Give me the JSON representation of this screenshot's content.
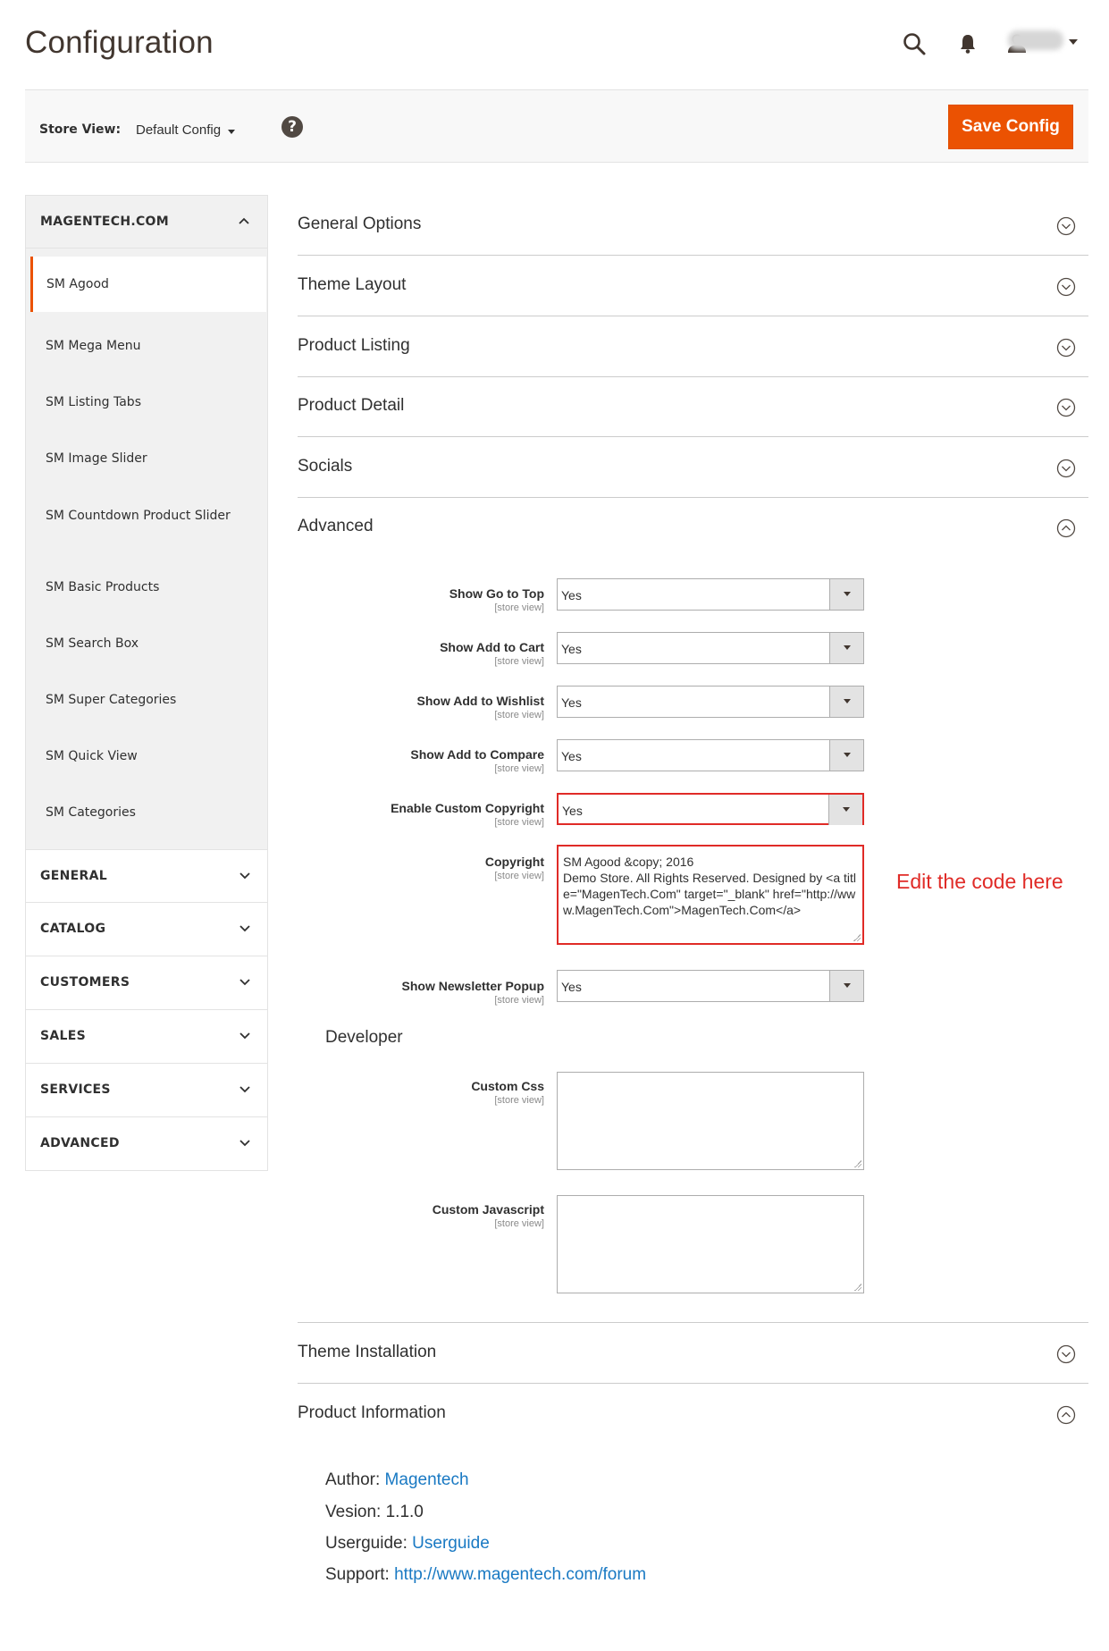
{
  "header": {
    "title": "Configuration",
    "icons": [
      "search-icon",
      "bell-icon",
      "user-icon"
    ]
  },
  "store_view": {
    "label": "Store View:",
    "value": "Default Config",
    "help": "?",
    "save_label": "Save Config"
  },
  "sidebar": {
    "tab_title": "MAGENTECH.COM",
    "items": [
      {
        "label": "SM Agood",
        "active": true
      },
      {
        "label": "SM Mega Menu"
      },
      {
        "label": "SM Listing Tabs"
      },
      {
        "label": "SM Image Slider"
      },
      {
        "label": "SM Countdown Product Slider"
      },
      {
        "label": "SM Basic Products"
      },
      {
        "label": "SM Search Box"
      },
      {
        "label": "SM Super Categories"
      },
      {
        "label": "SM Quick View"
      },
      {
        "label": "SM Categories"
      }
    ],
    "categories": [
      "GENERAL",
      "CATALOG",
      "CUSTOMERS",
      "SALES",
      "SERVICES",
      "ADVANCED"
    ]
  },
  "sections": {
    "general_options": "General Options",
    "theme_layout": "Theme Layout",
    "product_listing": "Product Listing",
    "product_detail": "Product Detail",
    "socials": "Socials",
    "advanced": "Advanced",
    "theme_installation": "Theme Installation",
    "product_information": "Product Information"
  },
  "advanced": {
    "scope": "[store view]",
    "fields": [
      {
        "label": "Show Go to Top",
        "value": "Yes"
      },
      {
        "label": "Show Add to Cart",
        "value": "Yes"
      },
      {
        "label": "Show Add to Wishlist",
        "value": "Yes"
      },
      {
        "label": "Show Add to Compare",
        "value": "Yes"
      },
      {
        "label": "Enable Custom Copyright",
        "value": "Yes"
      }
    ],
    "copyright": {
      "label": "Copyright",
      "value": "SM Agood &copy; 2016\nDemo Store. All Rights Reserved. Designed by <a title=\"MagenTech.Com\" target=\"_blank\" href=\"http://www.MagenTech.Com\">MagenTech.Com</a>"
    },
    "annotation": "Edit the code here",
    "newsletter": {
      "label": "Show Newsletter Popup",
      "value": "Yes"
    },
    "developer_title": "Developer",
    "custom_css": {
      "label": "Custom Css",
      "value": ""
    },
    "custom_js": {
      "label": "Custom Javascript",
      "value": ""
    }
  },
  "product_info": {
    "author_label": "Author:",
    "author_value": "Magentech",
    "version_label": "Vesion:",
    "version_value": "1.1.0",
    "userguide_label": "Userguide:",
    "userguide_value": "Userguide",
    "support_label": "Support:",
    "support_value": "http://www.magentech.com/forum"
  },
  "colors": {
    "accent": "#eb5202",
    "annotation": "#e02b27",
    "link": "#1979c3"
  }
}
